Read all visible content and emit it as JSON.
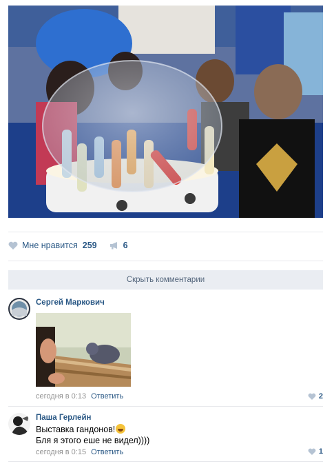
{
  "post": {
    "likes": {
      "label": "Мне нравится",
      "count": "259"
    },
    "shares": {
      "count": "6"
    },
    "hide_comments_label": "Скрыть комментарии"
  },
  "comments": [
    {
      "author": "Сергей Маркович",
      "time": "сегодня в 0:13",
      "reply_label": "Ответить",
      "likes": "2"
    },
    {
      "author": "Паша Герлейн",
      "text_line1": "Выставка гандонов!",
      "text_line2": "Бля я этого еше не видел))))",
      "time": "сегодня в 0:15",
      "reply_label": "Ответить",
      "likes": "1"
    }
  ],
  "icons": {
    "like": "heart-icon",
    "share": "megaphone-icon",
    "emoji": "grin-emoji-icon"
  },
  "colors": {
    "link": "#2a5885",
    "meta": "#939393",
    "divider": "#e7e8ec",
    "button_bg": "#eaedf2"
  }
}
